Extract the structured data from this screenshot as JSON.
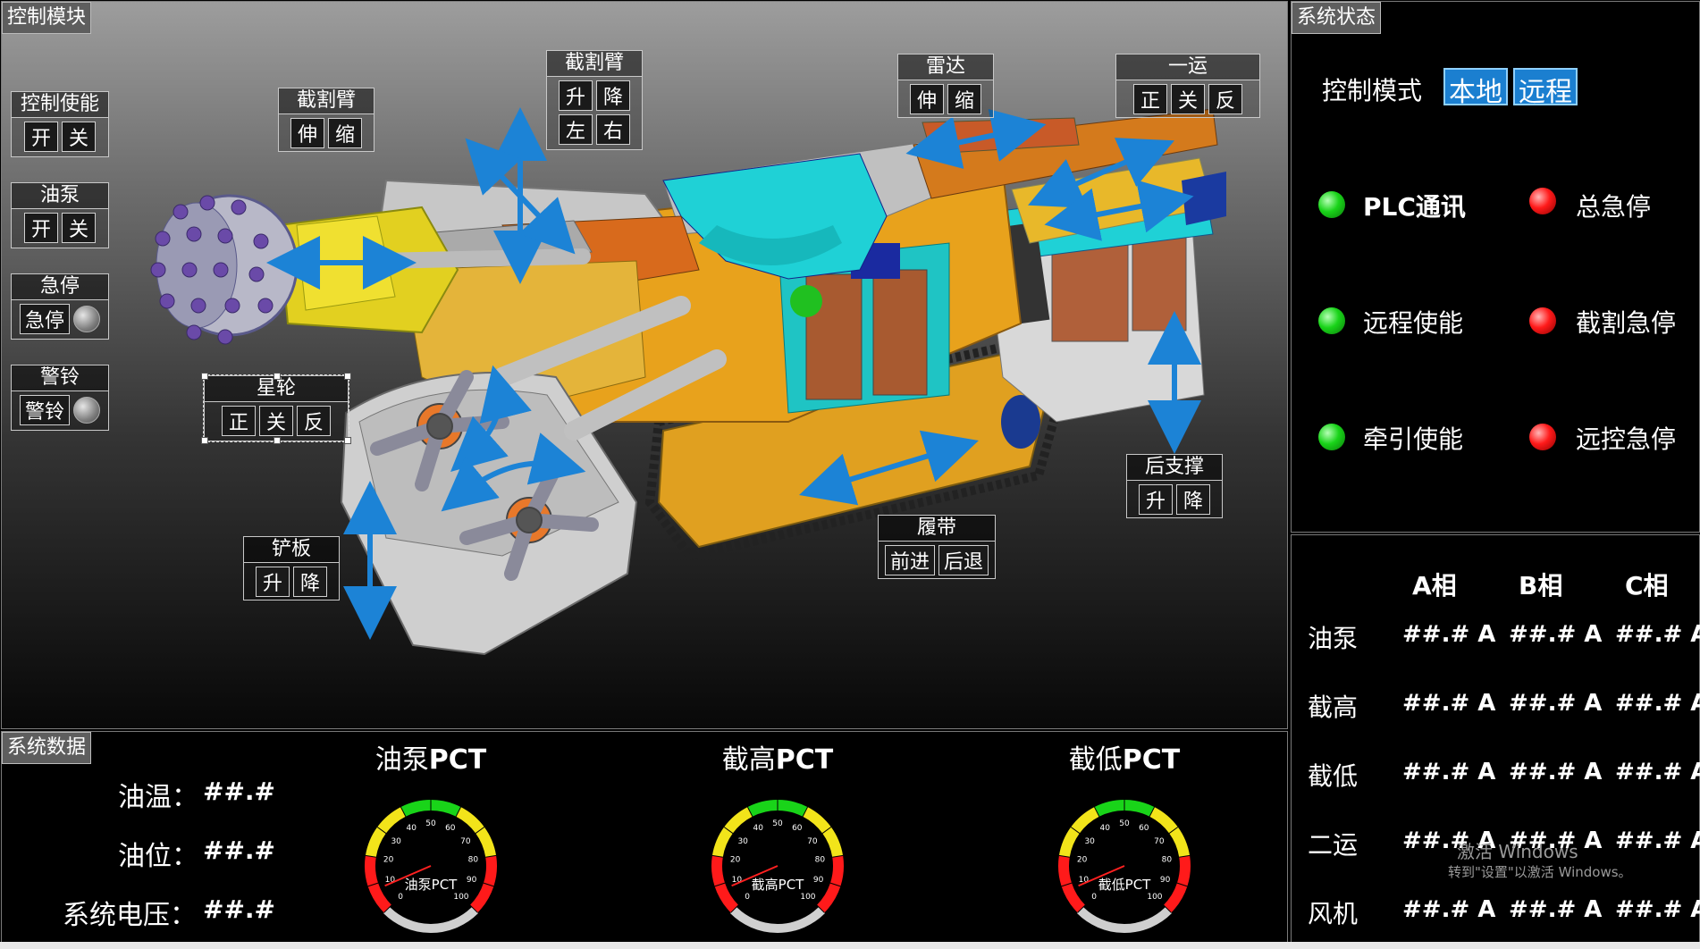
{
  "panels": {
    "control": "控制模块",
    "data": "系统数据",
    "status": "系统状态"
  },
  "controls": {
    "control_enable": {
      "title": "控制使能",
      "on": "开",
      "off": "关"
    },
    "oil_pump": {
      "title": "油泵",
      "on": "开",
      "off": "关"
    },
    "emergency_stop": {
      "title": "急停",
      "button": "急停"
    },
    "alarm_bell": {
      "title": "警铃",
      "button": "警铃"
    },
    "cutting_arm_extend": {
      "title": "截割臂",
      "extend": "伸",
      "retract": "缩"
    },
    "cutting_arm_move": {
      "title": "截割臂",
      "up": "升",
      "down": "降",
      "left": "左",
      "right": "右"
    },
    "radar": {
      "title": "雷达",
      "extend": "伸",
      "retract": "缩"
    },
    "conveyor_1": {
      "title": "一运",
      "forward": "正",
      "stop": "关",
      "reverse": "反"
    },
    "star_wheel": {
      "title": "星轮",
      "forward": "正",
      "stop": "关",
      "reverse": "反"
    },
    "rear_support": {
      "title": "后支撑",
      "up": "升",
      "down": "降"
    },
    "track": {
      "title": "履带",
      "forward": "前进",
      "backward": "后退"
    },
    "shovel_plate": {
      "title": "铲板",
      "up": "升",
      "down": "降"
    }
  },
  "status": {
    "mode_label": "控制模式",
    "mode_local": "本地",
    "mode_remote": "远程",
    "indicators": [
      {
        "label": "PLC通讯",
        "color": "green"
      },
      {
        "label": "总急停",
        "color": "red"
      },
      {
        "label": "远程使能",
        "color": "green"
      },
      {
        "label": "截割急停",
        "color": "red"
      },
      {
        "label": "牵引使能",
        "color": "green"
      },
      {
        "label": "远控急停",
        "color": "red"
      }
    ]
  },
  "phases": {
    "headers": [
      "A相",
      "B相",
      "C相"
    ],
    "rows": [
      {
        "name": "油泵",
        "values": [
          "##.# A",
          "##.# A",
          "##.# A"
        ]
      },
      {
        "name": "截高",
        "values": [
          "##.# A",
          "##.# A",
          "##.# A"
        ]
      },
      {
        "name": "截低",
        "values": [
          "##.# A",
          "##.# A",
          "##.# A"
        ]
      },
      {
        "name": "二运",
        "values": [
          "##.# A",
          "##.# A",
          "##.# A"
        ]
      },
      {
        "name": "风机",
        "values": [
          "##.# A",
          "##.# A",
          "##.# A"
        ]
      }
    ]
  },
  "system_data": [
    {
      "label": "油温：",
      "value": "##.#"
    },
    {
      "label": "油位：",
      "value": "##.#"
    },
    {
      "label": "系统电压：",
      "value": "##.#"
    }
  ],
  "gauges": [
    {
      "title_cn": "油泵",
      "title_en": "PCT",
      "label": "油泵PCT",
      "value": 8
    },
    {
      "title_cn": "截高",
      "title_en": "PCT",
      "label": "截高PCT",
      "value": 8
    },
    {
      "title_cn": "截低",
      "title_en": "PCT",
      "label": "截低PCT",
      "value": 8
    }
  ],
  "gauge_ticks": [
    "0",
    "10",
    "20",
    "30",
    "40",
    "50",
    "60",
    "70",
    "80",
    "90",
    "100"
  ],
  "watermark": {
    "line1": "激活 Windows",
    "line2": "转到\"设置\"以激活 Windows。"
  },
  "colors": {
    "accent": "#1b7fd0",
    "arrow": "#1c83d6",
    "ok": "#19d419",
    "alarm": "#ff1a1a",
    "machine_orange": "#e8a21c",
    "machine_cyan": "#1fd1d6"
  }
}
